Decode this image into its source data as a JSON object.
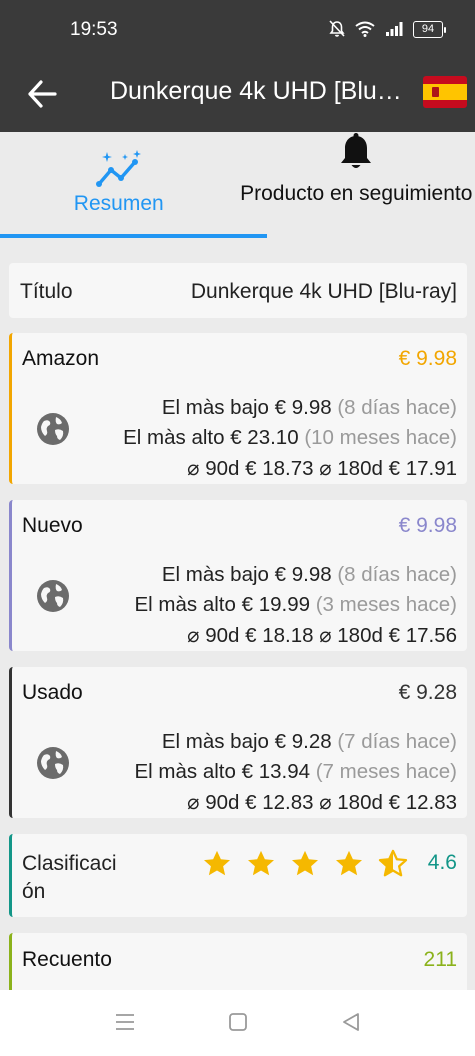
{
  "status_bar": {
    "time": "19:53",
    "battery": "94",
    "icons": [
      "mute-icon",
      "wifi-icon",
      "signal-icon",
      "battery-icon"
    ]
  },
  "app_bar": {
    "title": "Dunkerque 4k UHD [Blu-ray]",
    "back_icon": "arrow-left-icon",
    "flag": "spain-flag"
  },
  "tabs": [
    {
      "label": "Resumen",
      "icon": "sparkle-chart-icon",
      "active": true
    },
    {
      "label": "Producto en seguimiento",
      "icon": "bell-icon",
      "active": false
    }
  ],
  "colors": {
    "header": "#3a3a3a",
    "tab_active": "#2196f3",
    "amazon": "#f2a600",
    "nuevo": "#8a87cc",
    "usado": "#333333",
    "rating": "#139688",
    "count": "#8bb21b"
  },
  "product": {
    "title_label": "Título",
    "title_value": "Dunkerque 4k UHD [Blu-ray]"
  },
  "price_cards": [
    {
      "name": "Amazon",
      "price": "€ 9.98",
      "lowest_label": "El màs bajo",
      "lowest_price": "€ 9.98",
      "lowest_when": "(8 días hace)",
      "highest_label": "El màs alto",
      "highest_price": "€ 23.10",
      "highest_when": "(10 meses hace)",
      "avg90_label": "⌀ 90d",
      "avg90": "€ 18.73",
      "avg180_label": "⌀ 180d",
      "avg180": "€ 17.91"
    },
    {
      "name": "Nuevo",
      "price": "€ 9.98",
      "lowest_label": "El màs bajo",
      "lowest_price": "€ 9.98",
      "lowest_when": "(8 días hace)",
      "highest_label": "El màs alto",
      "highest_price": "€ 19.99",
      "highest_when": "(3 meses hace)",
      "avg90_label": "⌀ 90d",
      "avg90": "€ 18.18",
      "avg180_label": "⌀ 180d",
      "avg180": "€ 17.56"
    },
    {
      "name": "Usado",
      "price": "€ 9.28",
      "lowest_label": "El màs bajo",
      "lowest_price": "€ 9.28",
      "lowest_when": "(7 días hace)",
      "highest_label": "El màs alto",
      "highest_price": "€ 13.94",
      "highest_when": "(7 meses hace)",
      "avg90_label": "⌀ 90d",
      "avg90": "€ 12.83",
      "avg180_label": "⌀ 180d",
      "avg180": "€ 12.83"
    }
  ],
  "rating": {
    "label": "Clasificaci ón",
    "value": "4.6",
    "stars": 4.5
  },
  "count": {
    "label": "Recuento",
    "value": "211"
  },
  "nav_bar": {
    "icons": [
      "menu-icon",
      "home-square-icon",
      "back-triangle-icon"
    ]
  }
}
